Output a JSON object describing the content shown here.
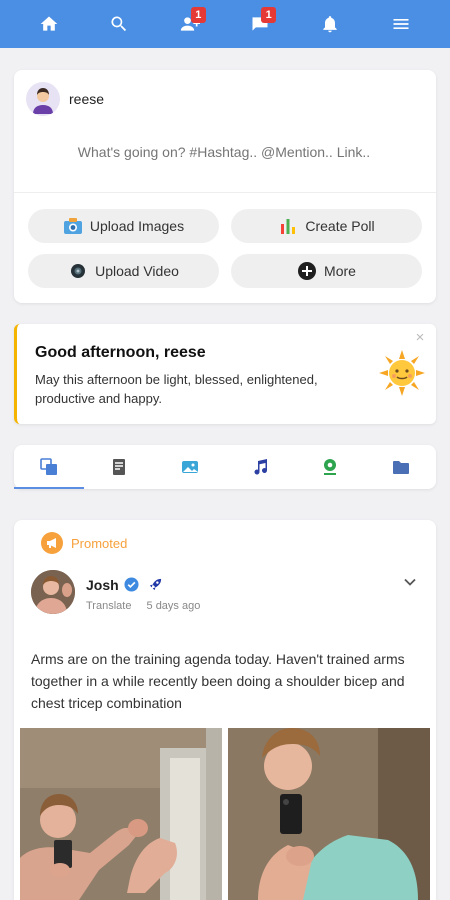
{
  "nav": {
    "items": [
      {
        "icon": "home-icon"
      },
      {
        "icon": "search-icon"
      },
      {
        "icon": "friend-requests-icon",
        "badge": "1"
      },
      {
        "icon": "messages-icon",
        "badge": "1"
      },
      {
        "icon": "notifications-icon"
      },
      {
        "icon": "menu-icon"
      }
    ],
    "color": "#4a8fe4"
  },
  "composer": {
    "username": "reese",
    "placeholder": "What's going on? #Hashtag.. @Mention.. Link..",
    "buttons": {
      "upload_images": "Upload Images",
      "create_poll": "Create Poll",
      "upload_video": "Upload Video",
      "more": "More"
    }
  },
  "greeting": {
    "title": "Good afternoon, reese",
    "message": "May this afternoon be light, blessed, enlightened, productive and happy.",
    "close": "×",
    "accent": "#f5b400"
  },
  "tabs": [
    {
      "icon": "all-posts-icon",
      "active": true
    },
    {
      "icon": "text-posts-icon"
    },
    {
      "icon": "photos-icon"
    },
    {
      "icon": "music-icon"
    },
    {
      "icon": "location-icon"
    },
    {
      "icon": "files-icon"
    }
  ],
  "post": {
    "promoted_label": "Promoted",
    "author": "Josh",
    "translate": "Translate",
    "time": "5 days ago",
    "text": "Arms are on the training agenda today. Haven't trained arms together in a while recently been doing a shoulder bicep and chest tricep combination",
    "promo_color": "#f7a13c"
  }
}
